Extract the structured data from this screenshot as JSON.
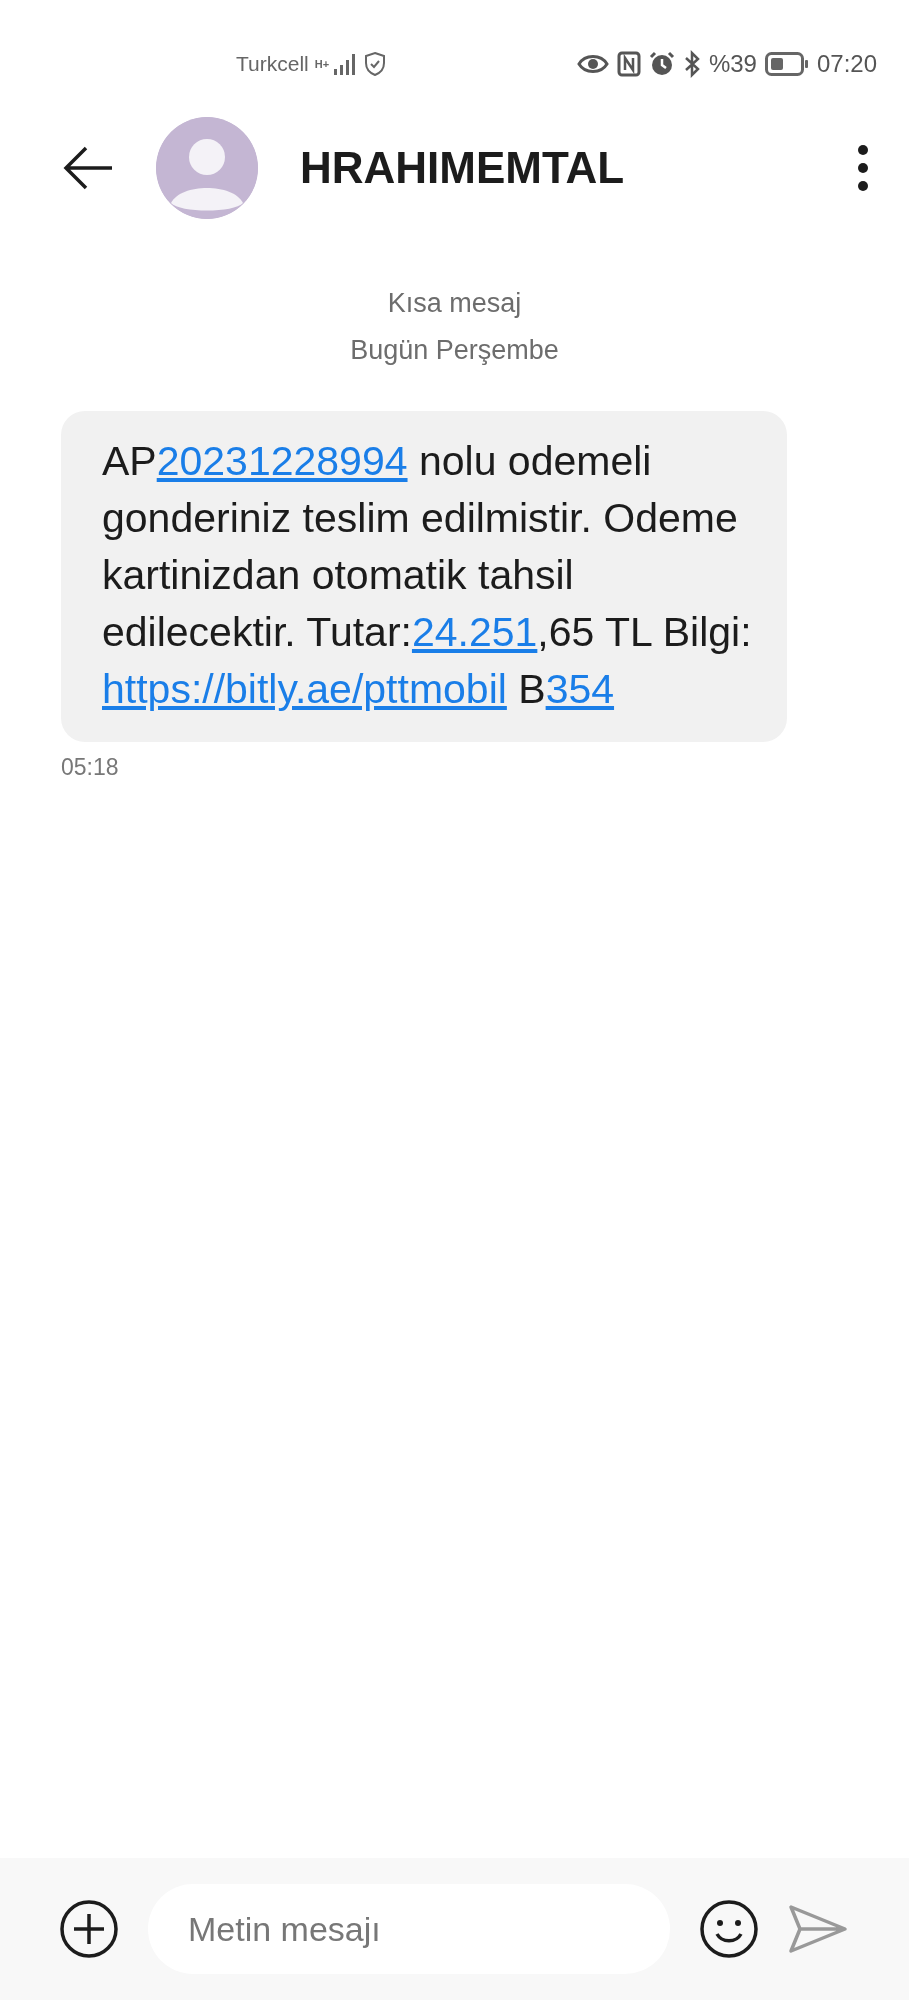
{
  "status_bar": {
    "carrier": "Turkcell",
    "network": "H+",
    "battery_percent": "%39",
    "time": "07:20"
  },
  "header": {
    "title": "HRAHIMEMTAL"
  },
  "conversation": {
    "type_label": "Kısa mesaj",
    "date_label": "Bugün Perşembe"
  },
  "messages": [
    {
      "segments": [
        {
          "kind": "text",
          "text": "AP"
        },
        {
          "kind": "link",
          "text": "20231228994"
        },
        {
          "kind": "text",
          "text": " nolu odemeli gonderiniz teslim edilmistir. Odeme kartinizdan otomatik tahsil edilecektir. Tutar:"
        },
        {
          "kind": "link",
          "text": "24.251"
        },
        {
          "kind": "text",
          "text": ",65 TL Bilgi: "
        },
        {
          "kind": "link",
          "text": "https://bitly.ae/pttmobil"
        },
        {
          "kind": "text",
          "text": " B"
        },
        {
          "kind": "link",
          "text": "354"
        }
      ],
      "time": "05:18"
    }
  ],
  "composer": {
    "placeholder": "Metin mesajı"
  }
}
